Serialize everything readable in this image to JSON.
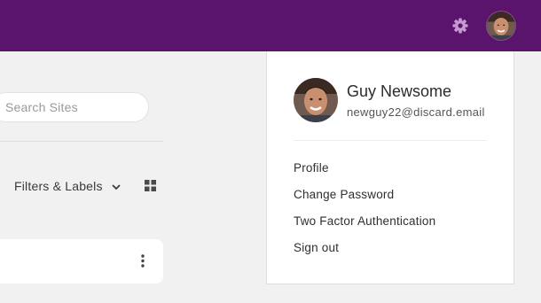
{
  "header": {
    "background_color": "#5a146b",
    "settings_icon": "gear-icon",
    "settings_icon_color": "#c59ad2",
    "avatar_icon": "user-avatar"
  },
  "search": {
    "placeholder": "Search Sites"
  },
  "filters": {
    "label": "Filters & Labels",
    "dropdown_icon": "chevron-down-icon",
    "view_icon": "grid-view-icon"
  },
  "card": {
    "menu_icon": "more-vertical-icon"
  },
  "user_menu": {
    "name": "Guy Newsome",
    "email": "newguy22@discard.email",
    "items": [
      {
        "label": "Profile"
      },
      {
        "label": "Change Password"
      },
      {
        "label": "Two Factor Authentication"
      },
      {
        "label": "Sign out"
      }
    ]
  }
}
